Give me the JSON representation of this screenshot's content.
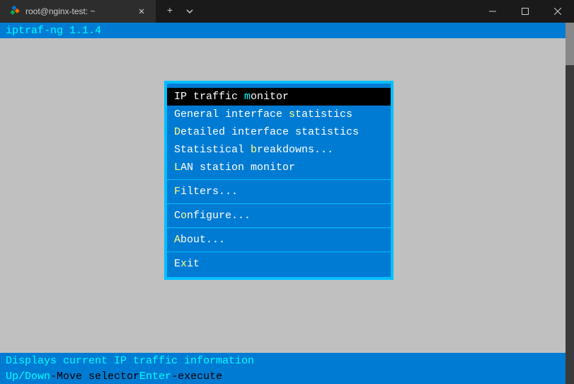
{
  "titlebar": {
    "tab_title": "root@nginx-test: ~"
  },
  "top_bar": {
    "app_title": "iptraf-ng 1.1.4"
  },
  "menu": {
    "items": [
      {
        "pre": "IP traffic ",
        "hot": "m",
        "post": "onitor",
        "selected": true
      },
      {
        "pre": "General interface ",
        "hot": "s",
        "post": "tatistics",
        "selected": false
      },
      {
        "pre": "",
        "hot": "D",
        "post": "etailed interface statistics",
        "selected": false
      },
      {
        "pre": "Statistical ",
        "hot": "b",
        "post": "reakdowns...",
        "selected": false
      },
      {
        "pre": "",
        "hot": "L",
        "post": "AN station monitor",
        "selected": false
      },
      {
        "divider": true
      },
      {
        "pre": "",
        "hot": "F",
        "post": "ilters...",
        "selected": false
      },
      {
        "divider": true
      },
      {
        "pre": "C",
        "hot": "o",
        "post": "nfigure...",
        "selected": false
      },
      {
        "divider": true
      },
      {
        "pre": "",
        "hot": "A",
        "post": "bout...",
        "selected": false
      },
      {
        "divider": true
      },
      {
        "pre": "E",
        "hot": "x",
        "post": "it",
        "selected": false
      }
    ]
  },
  "status": {
    "description": "Displays current IP traffic information"
  },
  "hints": {
    "key1": "Up/Down",
    "label1": "-Move selector  ",
    "key2": "Enter",
    "label2": "-execute"
  }
}
